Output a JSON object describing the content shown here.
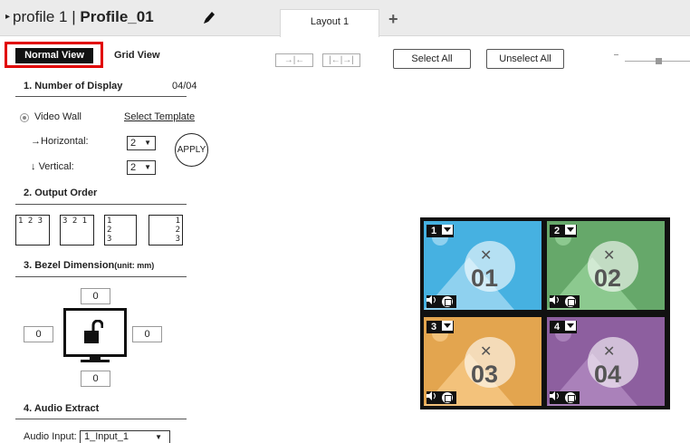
{
  "header": {
    "profile_prefix": "profile 1 |",
    "profile_name": "Profile_01",
    "tab_label": "Layout 1",
    "add_tab_icon": "plus-icon",
    "edit_icon": "pencil-icon"
  },
  "view": {
    "normal": "Normal View",
    "grid": "Grid View"
  },
  "sections": {
    "s1": "1.  Number of Display",
    "s1_count": "04/04",
    "s2": "2.  Output Order",
    "s3": "3.  Bezel Dimension",
    "s3_unit": "(unit: mm)",
    "s4": "4.  Audio Extract"
  },
  "display": {
    "mode": "Video Wall",
    "select_template": "Select Template",
    "horizontal_label": "Horizontal:",
    "horizontal_value": "2",
    "vertical_label": "Vertical:",
    "vertical_value": "2",
    "apply": "APPLY"
  },
  "output_order": [
    "1 2 3",
    "3 2 1",
    "1\n2\n3",
    "1\n2\n3"
  ],
  "bezel": {
    "top": "0",
    "left": "0",
    "right": "0",
    "bottom": "0"
  },
  "audio": {
    "label": "Audio Input:",
    "value": "1_Input_1"
  },
  "toolbar": {
    "select_all": "Select All",
    "unselect_all": "Unselect All"
  },
  "wall": {
    "cells": [
      {
        "no": "1",
        "label": "01",
        "bg": "#46b1e1",
        "mountain": "#8fd1ef"
      },
      {
        "no": "2",
        "label": "02",
        "bg": "#66a86a",
        "mountain": "#8cc98f"
      },
      {
        "no": "3",
        "label": "03",
        "bg": "#e3a54f",
        "mountain": "#f3c27b"
      },
      {
        "no": "4",
        "label": "04",
        "bg": "#8d5f9f",
        "mountain": "#aa81ba"
      }
    ]
  }
}
